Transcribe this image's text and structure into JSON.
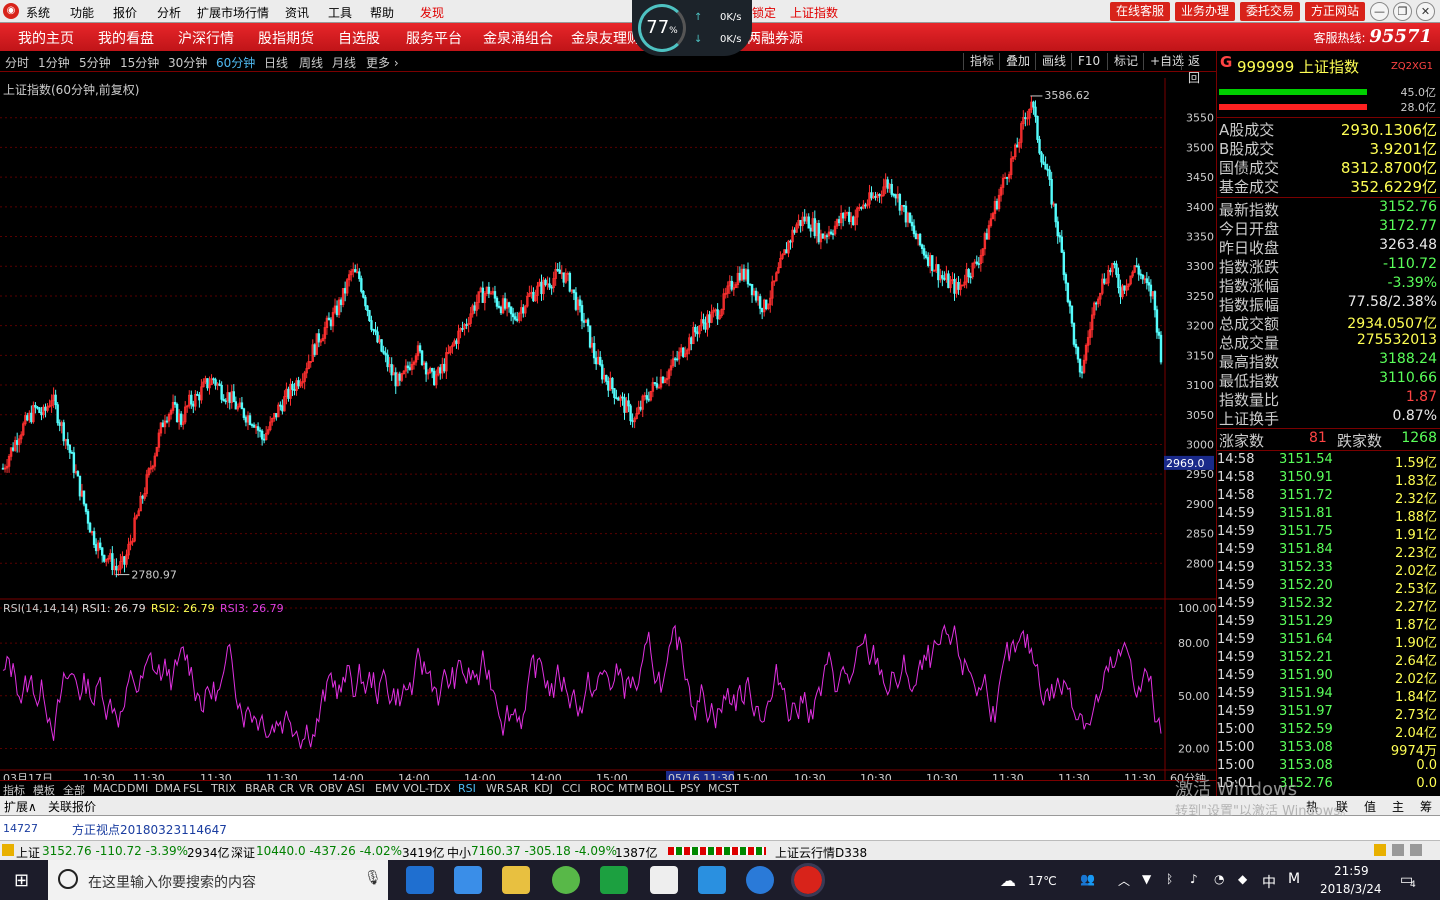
{
  "menu": {
    "items": [
      "系统",
      "功能",
      "报价",
      "分析",
      "扩展市场行情",
      "资讯",
      "工具",
      "帮助",
      "发现"
    ],
    "lock_text": "交易已锁定",
    "index_tag": "上证指数",
    "buttons": [
      "在线客服",
      "业务办理",
      "委托交易",
      "方正网站"
    ]
  },
  "speed": {
    "percent": "77",
    "unit": "%",
    "up": "0K/s",
    "down": "0K/s"
  },
  "nav": {
    "items": [
      "我的主页",
      "我的看盘",
      "沪深行情",
      "股指期货",
      "自选股",
      "服务平台",
      "金泉涌组合",
      "金泉友理财",
      "两融券源"
    ],
    "hotline_label": "客服热线:",
    "hotline": "95571"
  },
  "periods": {
    "items": [
      "分时",
      "1分钟",
      "5分钟",
      "15分钟",
      "30分钟",
      "60分钟",
      "日线",
      "周线",
      "月线",
      "更多 ›"
    ],
    "active": 5,
    "tools": [
      "指标",
      "叠加",
      "画线",
      "F10",
      "标记",
      "+自选",
      "返回"
    ]
  },
  "chart": {
    "title": "上证指数(60分钟,前复权)",
    "high_label": "3586.62",
    "low_label": "2780.97",
    "cursor_price": "2969.0",
    "y_ticks": [
      "3550",
      "3500",
      "3450",
      "3400",
      "3350",
      "3300",
      "3250",
      "3200",
      "3150",
      "3100",
      "3050",
      "3000",
      "2950",
      "2900",
      "2850",
      "2800"
    ],
    "rsi_title": "RSI(14,14,14)",
    "rsi1": "RSI1: 26.79",
    "rsi2": "RSI2: 26.79",
    "rsi3": "RSI3: 26.79",
    "rsi_ticks": [
      "100.00",
      "80.00",
      "50.00",
      "20.00"
    ],
    "x_labels": [
      "03月17日",
      "10:30",
      "11:30",
      "11:30",
      "11:30",
      "14:00",
      "14:00",
      "14:00",
      "14:00",
      "15:00",
      "05/16 11:30",
      "15:00",
      "10:30",
      "10:30",
      "10:30",
      "11:30",
      "11:30",
      "11:30"
    ],
    "period_label": "60分钟"
  },
  "chart_data": {
    "type": "candlestick",
    "title": "上证指数(60分钟,前复权)",
    "ylim": [
      2750,
      3600
    ],
    "high": 3586.62,
    "low": 2780.97,
    "close": [
      2960,
      2990,
      3020,
      3040,
      3060,
      3050,
      3080,
      3040,
      3000,
      2950,
      2900,
      2850,
      2820,
      2810,
      2790,
      2800,
      2850,
      2900,
      2950,
      3000,
      3050,
      3060,
      3040,
      3070,
      3080,
      3100,
      3110,
      3090,
      3080,
      3060,
      3050,
      3040,
      3010,
      3030,
      3060,
      3080,
      3100,
      3120,
      3150,
      3180,
      3200,
      3220,
      3250,
      3290,
      3280,
      3230,
      3180,
      3150,
      3120,
      3100,
      3130,
      3160,
      3140,
      3110,
      3120,
      3150,
      3180,
      3200,
      3230,
      3250,
      3260,
      3240,
      3230,
      3210,
      3230,
      3250,
      3260,
      3270,
      3280,
      3290,
      3270,
      3230,
      3200,
      3150,
      3120,
      3100,
      3080,
      3060,
      3040,
      3070,
      3090,
      3110,
      3120,
      3140,
      3160,
      3180,
      3200,
      3210,
      3220,
      3240,
      3270,
      3290,
      3280,
      3250,
      3230,
      3260,
      3300,
      3340,
      3370,
      3380,
      3370,
      3350,
      3360,
      3370,
      3390,
      3380,
      3400,
      3410,
      3420,
      3440,
      3430,
      3400,
      3370,
      3340,
      3320,
      3300,
      3280,
      3270,
      3260,
      3290,
      3300,
      3330,
      3380,
      3420,
      3460,
      3490,
      3540,
      3580,
      3500,
      3450,
      3380,
      3300,
      3200,
      3110,
      3180,
      3250,
      3280,
      3300,
      3260,
      3280,
      3300,
      3270,
      3250,
      3152.76
    ],
    "rsi_last": 26.79
  },
  "panel": {
    "g": "G",
    "code": "999999 上证指数",
    "small": "ZQ2XG1",
    "pct1": "45.0亿",
    "pct2": "28.0亿",
    "vol": [
      {
        "label": "A股成交",
        "value": "2930.1306亿"
      },
      {
        "label": "B股成交",
        "value": "3.9201亿"
      },
      {
        "label": "国债成交",
        "value": "8312.8700亿"
      },
      {
        "label": "基金成交",
        "value": "352.6229亿"
      }
    ],
    "stats": [
      {
        "label": "最新指数",
        "value": "3152.76",
        "c": "#5aff5a"
      },
      {
        "label": "今日开盘",
        "value": "3172.77",
        "c": "#5aff5a"
      },
      {
        "label": "昨日收盘",
        "value": "3263.48",
        "c": "#e8e8e8"
      },
      {
        "label": "指数涨跌",
        "value": "-110.72",
        "c": "#5aff5a"
      },
      {
        "label": "指数涨幅",
        "value": "-3.39%",
        "c": "#5aff5a"
      },
      {
        "label": "指数振幅",
        "value": "77.58/2.38%",
        "c": "#e8e8e8"
      },
      {
        "label": "总成交额",
        "value": "2934.0507亿",
        "c": "#ffff54"
      },
      {
        "label": "总成交量",
        "value": "275532013",
        "c": "#ffff54"
      },
      {
        "label": "最高指数",
        "value": "3188.24",
        "c": "#5aff5a"
      },
      {
        "label": "最低指数",
        "value": "3110.66",
        "c": "#5aff5a"
      },
      {
        "label": "指数量比",
        "value": "1.87",
        "c": "#ff4444"
      },
      {
        "label": "上证换手",
        "value": "0.87%",
        "c": "#e8e8e8"
      }
    ],
    "up_label": "涨家数",
    "up": "81",
    "down_label": "跌家数",
    "down": "1268",
    "ticks": [
      [
        "14:58",
        "3151.54",
        "1.59亿"
      ],
      [
        "14:58",
        "3150.91",
        "1.83亿"
      ],
      [
        "14:58",
        "3151.72",
        "2.32亿"
      ],
      [
        "14:59",
        "3151.81",
        "1.88亿"
      ],
      [
        "14:59",
        "3151.75",
        "1.91亿"
      ],
      [
        "14:59",
        "3151.84",
        "2.23亿"
      ],
      [
        "14:59",
        "3152.33",
        "2.02亿"
      ],
      [
        "14:59",
        "3152.20",
        "2.53亿"
      ],
      [
        "14:59",
        "3152.32",
        "2.27亿"
      ],
      [
        "14:59",
        "3151.29",
        "1.87亿"
      ],
      [
        "14:59",
        "3151.64",
        "1.90亿"
      ],
      [
        "14:59",
        "3152.21",
        "2.64亿"
      ],
      [
        "14:59",
        "3151.90",
        "2.02亿"
      ],
      [
        "14:59",
        "3151.94",
        "1.84亿"
      ],
      [
        "14:59",
        "3151.97",
        "2.73亿"
      ],
      [
        "15:00",
        "3152.59",
        "2.04亿"
      ],
      [
        "15:00",
        "3153.08",
        "9974万"
      ],
      [
        "15:00",
        "3153.08",
        "0.0"
      ],
      [
        "15:01",
        "3152.76",
        "0.0"
      ]
    ]
  },
  "indicators": {
    "items": [
      "指标",
      "模板",
      "全部",
      "MACD",
      "DMI",
      "DMA",
      "FSL",
      "TRIX",
      "BRAR",
      "CR",
      "VR",
      "OBV",
      "ASI",
      "EMV",
      "VOL-TDX",
      "RSI",
      "WR",
      "SAR",
      "KDJ",
      "CCI",
      "ROC",
      "MTM",
      "BOLL",
      "PSY",
      "MCST"
    ],
    "active": 15
  },
  "tabs": {
    "left": [
      "扩展∧",
      "关联报价"
    ],
    "right": [
      "热",
      "联",
      "值",
      "主",
      "筹"
    ]
  },
  "watermark": {
    "line1": "激活 Windows",
    "line2": "转到\"设置\"以激活 Windows。"
  },
  "news": {
    "code": "14727",
    "text": "方正视点20180323114647"
  },
  "status": {
    "sh_label": "上证",
    "sh": "3152.76 -110.72 -3.39%",
    "sh_amt": "2934亿",
    "sz_label": "深证",
    "sz": "10440.0 -437.26 -4.02%",
    "sz_amt": "3419亿",
    "zx_label": "中小",
    "zx": "7160.37 -305.18 -4.09%",
    "zx_amt": "1387亿",
    "cloud": "上证云行情D338"
  },
  "taskbar": {
    "search": "在这里输入你要搜索的内容",
    "weather": "17℃",
    "ime": "中",
    "time": "21:59",
    "date": "2018/3/24",
    "notify": "4"
  }
}
